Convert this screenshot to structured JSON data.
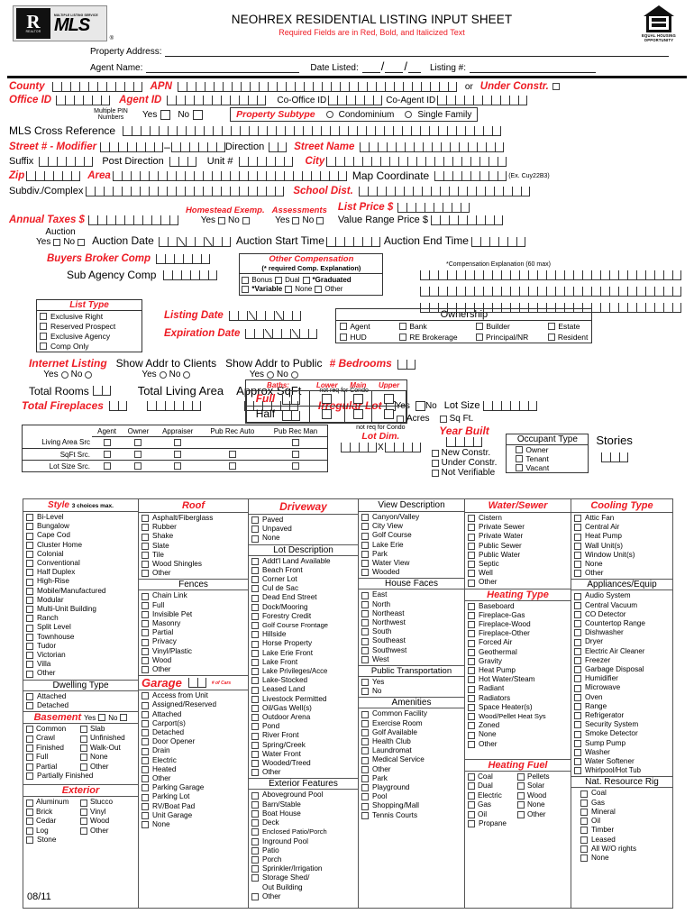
{
  "header": {
    "title": "NEOHREX RESIDENTIAL LISTING INPUT SHEET",
    "subtitle": "Required Fields are in Red, Bold, and Italicized Text",
    "logo_realtor": "REALTOR",
    "logo_mls_small": "MULTIPLE LISTING SERVICE",
    "logo_mls": "MLS",
    "logo_reg": "®",
    "eh_line1": "EQUAL HOUSING",
    "eh_line2": "OPPORTUNITY",
    "property_address_label": "Property Address:",
    "agent_name_label": "Agent Name:",
    "date_listed_label": "Date Listed:",
    "listing_num_label": "Listing #:"
  },
  "fields": {
    "county": "County",
    "apn": "APN",
    "or": "or",
    "under_constr": "Under Constr.",
    "office_id": "Office ID",
    "agent_id": "Agent ID",
    "co_office_id": "Co-Office ID",
    "co_agent_id": "Co-Agent ID",
    "multiple_pin": "Multiple PIN Numbers",
    "yes": "Yes",
    "no": "No",
    "property_subtype": "Property Subtype",
    "condominium": "Condominium",
    "single_family": "Single Family",
    "mls_cross_reference": "MLS Cross Reference",
    "street_modifier": "Street # - Modifier",
    "direction": "Direction",
    "street_name": "Street Name",
    "suffix": "Suffix",
    "post_direction": "Post Direction",
    "unit": "Unit #",
    "city": "City",
    "zip": "Zip",
    "area": "Area",
    "map_coordinate": "Map Coordinate",
    "map_example": "(Ex. Cuy22B3)",
    "subdiv": "Subdiv./Complex",
    "school_dist": "School Dist.",
    "annual_taxes": "Annual Taxes $",
    "homestead": "Homestead Exemp.",
    "assessments": "Assessments",
    "list_price": "List Price $",
    "value_range": "Value Range Price $",
    "auction": "Auction",
    "auction_date": "Auction Date",
    "auction_start": "Auction Start Time",
    "auction_end": "Auction End Time",
    "comp_explanation": "*Compensation Explanation (60 max)",
    "buyers_broker_comp": "Buyers Broker Comp",
    "sub_agency_comp": "Sub Agency Comp",
    "listing_date": "Listing Date",
    "expiration_date": "Expiration Date",
    "internet_listing": "Internet Listing",
    "show_addr_clients": "Show Addr to Clients",
    "show_addr_public": "Show Addr to Public",
    "bedrooms": "# Bedrooms",
    "total_rooms": "Total Rooms",
    "total_living_area": "Total Living Area",
    "approx_sqft": "Approx SqFt",
    "total_fireplaces": "Total Fireplaces",
    "not_req_condo": "not req for Condo",
    "irregular_lot": "Irregular Lot",
    "lot_size": "Lot Size",
    "acres": "Acres",
    "sq_ft": "Sq Ft.",
    "year_built": "Year Built",
    "new_constr": "New Constr.",
    "under_constr2": "Under Constr.",
    "not_verifiable": "Not Verifiable",
    "stories": "Stories",
    "lot_dim": "Lot Dim.",
    "x": "X",
    "footer_date": "08/11"
  },
  "other_compensation": {
    "title": "Other Compensation",
    "note": "(* required Comp. Explanation)",
    "options": [
      "Bonus",
      "Dual",
      "*Graduated",
      "*Variable",
      "None",
      "Other"
    ]
  },
  "list_type": {
    "title": "List Type",
    "options": [
      "Exclusive Right",
      "Reserved Prospect",
      "Exclusive Agency",
      "Comp Only"
    ]
  },
  "ownership": {
    "title": "Ownership",
    "row1": [
      "Agent",
      "Bank",
      "Builder",
      "Estate"
    ],
    "row2": [
      "HUD",
      "RE Brokerage",
      "Principal/NR",
      "Resident"
    ]
  },
  "baths": {
    "title": "Baths:",
    "cols": [
      "Lower",
      "Main",
      "Upper"
    ],
    "rows": [
      "Full",
      "Half"
    ]
  },
  "occupant_type": {
    "title": "Occupant Type",
    "options": [
      "Owner",
      "Tenant",
      "Vacant"
    ]
  },
  "source_table": {
    "columns": [
      "Agent",
      "Owner",
      "Appraiser",
      "Pub Rec Auto",
      "Pub Rec Man"
    ],
    "rows": [
      {
        "label": "Living Area Src",
        "checks": [
          true,
          true,
          true,
          false,
          true
        ]
      },
      {
        "label": "SqFt Src.",
        "checks": [
          true,
          true,
          true,
          true,
          true
        ]
      },
      {
        "label": "Lot Size Src.",
        "checks": [
          true,
          true,
          true,
          true,
          true
        ]
      }
    ]
  },
  "columns": [
    {
      "sections": [
        {
          "title": "Style",
          "title_red": true,
          "note": "3 choices max.",
          "items": [
            "Bi-Level",
            "Bungalow",
            "Cape Cod",
            "Cluster Home",
            "Colonial",
            "Conventional",
            " Half Duplex",
            "High-Rise",
            "Mobile/Manufactured",
            "Modular",
            "Multi-Unit Building",
            "Ranch",
            "Split Level",
            "Townhouse",
            "Tudor",
            "Victorian",
            "Villa",
            "Other"
          ]
        },
        {
          "title": "Dwelling Type",
          "title_red": false,
          "items": [
            "Attached",
            "Detached"
          ]
        },
        {
          "title": "Basement",
          "title_red": true,
          "yesno": true,
          "two_col": [
            [
              "Common",
              "Crawl",
              "Finished",
              "Full",
              "Partial"
            ],
            [
              "Slab",
              "Unfinished",
              "Walk-Out",
              "None",
              "Other"
            ]
          ],
          "items_after": [
            "Partially Finished"
          ]
        },
        {
          "title": "Exterior",
          "title_red": true,
          "two_col": [
            [
              "Aluminum",
              "Brick",
              "Cedar",
              "Log",
              "Stone"
            ],
            [
              "Stucco",
              "Vinyl",
              "Wood",
              "Other"
            ]
          ]
        }
      ]
    },
    {
      "sections": [
        {
          "title": "Roof",
          "title_red": true,
          "items": [
            "Asphalt/Fiberglass",
            "Rubber",
            "Shake",
            "Slate",
            "Tile",
            "Wood Shingles",
            "Other"
          ]
        },
        {
          "title": "Fences",
          "title_red": false,
          "items": [
            "Chain Link",
            "Full",
            "Invisible Pet",
            "Masonry",
            "Partial",
            "Privacy",
            "Vinyl/Plastic",
            "Wood",
            "Other"
          ]
        },
        {
          "title": "Garage",
          "title_red": true,
          "cars_label": "# of Cars",
          "cars_field": true,
          "items": [
            "Access from Unit",
            "Assigned/Reserved",
            "Attached",
            "Carport(s)",
            "Detached",
            "Door Opener",
            "Drain",
            "Electric",
            "Heated",
            "Other",
            "Parking Garage",
            "Parking Lot",
            "RV/Boat Pad",
            "Unit Garage",
            "None"
          ]
        }
      ]
    },
    {
      "sections": [
        {
          "title": "Driveway",
          "title_red": true,
          "items": [
            "Paved",
            "Unpaved",
            "None"
          ]
        },
        {
          "title": "Lot Description",
          "title_red": false,
          "items": [
            "Addt'l Land Available",
            "Beach Front",
            "Corner Lot",
            "Cul de Sac",
            "Dead End Street",
            "Dock/Mooring",
            "Forestry Credit",
            "Golf Course Frontage",
            "Hillside",
            "Horse Property",
            "Lake Erie Front",
            "Lake Front",
            "Lake Privileges/Acce",
            "Lake-Stocked",
            "Leased Land",
            "Livestock Permitted",
            "Oil/Gas Well(s)",
            "Outdoor Arena",
            "Pond",
            "River Front",
            "Spring/Creek",
            "Water Front",
            "Wooded/Treed",
            "Other"
          ]
        },
        {
          "title": "Exterior Features",
          "title_red": false,
          "items": [
            "Aboveground Pool",
            "Barn/Stable",
            "Boat House",
            "Deck",
            "Enclosed Patio/Porch",
            "Inground Pool",
            "Patio",
            "Porch",
            "Sprinkler/Irrigation",
            "Storage Shed/",
            "Out Building",
            "Other"
          ]
        }
      ]
    },
    {
      "sections": [
        {
          "title": "View Description",
          "title_red": false,
          "items": [
            "Canyon/Valley",
            "City View",
            "Golf Course",
            "Lake Erie",
            "Park",
            "Water View",
            "Wooded"
          ]
        },
        {
          "title": "House Faces",
          "title_red": false,
          "items": [
            "East",
            "North",
            "Northeast",
            "Northwest",
            "South",
            "Southeast",
            "Southwest",
            "West"
          ]
        },
        {
          "title": "Public Transportation",
          "title_red": false,
          "items": [
            "Yes",
            "No"
          ]
        },
        {
          "title": "Amenities",
          "title_red": false,
          "items": [
            "Common Facility",
            "Exercise Room",
            "Golf Available",
            "Health Club",
            "Laundromat",
            "Medical Service",
            "Other",
            "Park",
            "Playground",
            "Pool",
            "Shopping/Mall",
            "Tennis Courts"
          ]
        }
      ]
    },
    {
      "sections": [
        {
          "title": "Water/Sewer",
          "title_red": true,
          "items": [
            "Cistern",
            "Private Sewer",
            "Private Water",
            "Public Sewer",
            "Public Water",
            "Septic",
            "Well",
            "Other"
          ]
        },
        {
          "title": "Heating Type",
          "title_red": true,
          "items": [
            "Baseboard",
            "Fireplace-Gas",
            "Fireplace-Wood",
            "Fireplace-Other",
            "Forced Air",
            "Geothermal",
            "Gravity",
            "Heat Pump",
            "Hot Water/Steam",
            "Radiant",
            "Radiators",
            "Space Heater(s)",
            "Wood/Pellet Heat Sys",
            "Zoned",
            "None",
            "Other"
          ]
        },
        {
          "title": "Heating Fuel",
          "title_red": true,
          "two_col": [
            [
              "Coal",
              "Dual",
              "Electric",
              "Gas",
              "Oil",
              "Propane"
            ],
            [
              "Pellets",
              "Solar",
              "Wood",
              "None",
              "Other"
            ]
          ]
        }
      ]
    },
    {
      "sections": [
        {
          "title": "Cooling Type",
          "title_red": true,
          "items": [
            "Attic Fan",
            "Central Air",
            "Heat Pump",
            "Wall Unit(s)",
            "Window Unit(s)",
            "None",
            "Other"
          ]
        },
        {
          "title": "Appliances/Equip",
          "title_red": false,
          "items": [
            "Audio System",
            "Central Vacuum",
            "CO Detector",
            "Countertop Range",
            "Dishwasher",
            "Dryer",
            "Electric Air Cleaner",
            "Freezer",
            "Garbage Disposal",
            "Humidifier",
            "Microwave",
            "Oven",
            "Range",
            "Refrigerator",
            "Security System",
            "Smoke Detector",
            "Sump Pump",
            "Washer",
            "Water Softener",
            "Whirlpool/Hot Tub"
          ]
        },
        {
          "title": "Nat. Resource Rig",
          "title_red": false,
          "items": [
            "Coal",
            "Gas",
            "Mineral",
            "Oil",
            "Timber",
            "Leased",
            "All W/O rights",
            "None"
          ]
        }
      ]
    }
  ],
  "colors": {
    "red": "#ED1C24",
    "black": "#000000",
    "border": "#555555"
  }
}
